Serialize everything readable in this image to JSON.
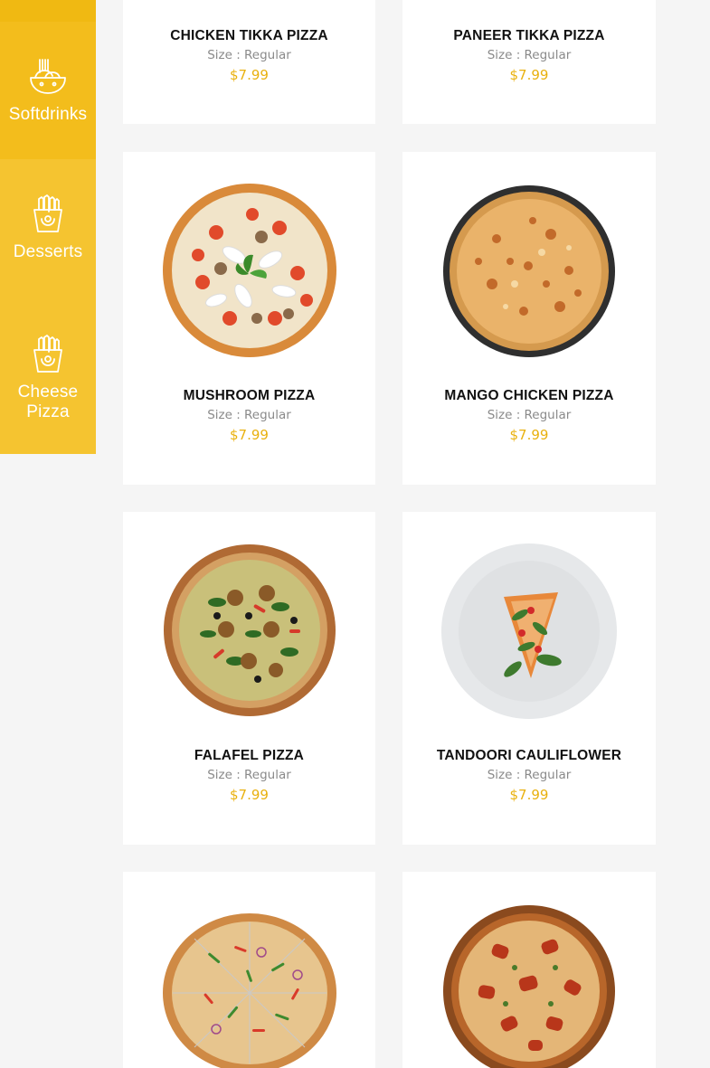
{
  "sidebar": {
    "items": [
      {
        "label": "Softdrinks",
        "icon": "bowl-icon"
      },
      {
        "label": "Desserts",
        "icon": "fries-icon"
      },
      {
        "label": "Cheese Pizza",
        "label_line1": "Cheese",
        "label_line2": "Pizza",
        "icon": "fries-icon"
      }
    ]
  },
  "colors": {
    "accent": "#f5c430",
    "price": "#e9b10f"
  },
  "products": [
    {
      "name": "CHICKEN TIKKA PIZZA",
      "size": "Size : Regular",
      "price": "$7.99"
    },
    {
      "name": "PANEER TIKKA PIZZA",
      "size": "Size : Regular",
      "price": "$7.99"
    },
    {
      "name": "MUSHROOM PIZZA",
      "size": "Size : Regular",
      "price": "$7.99"
    },
    {
      "name": "MANGO CHICKEN PIZZA",
      "size": "Size : Regular",
      "price": "$7.99"
    },
    {
      "name": "FALAFEL PIZZA",
      "size": "Size : Regular",
      "price": "$7.99"
    },
    {
      "name": "TANDOORI CAULIFLOWER",
      "size": "Size : Regular",
      "price": "$7.99"
    },
    {
      "name": "",
      "size": "",
      "price": ""
    },
    {
      "name": "",
      "size": "",
      "price": ""
    }
  ]
}
